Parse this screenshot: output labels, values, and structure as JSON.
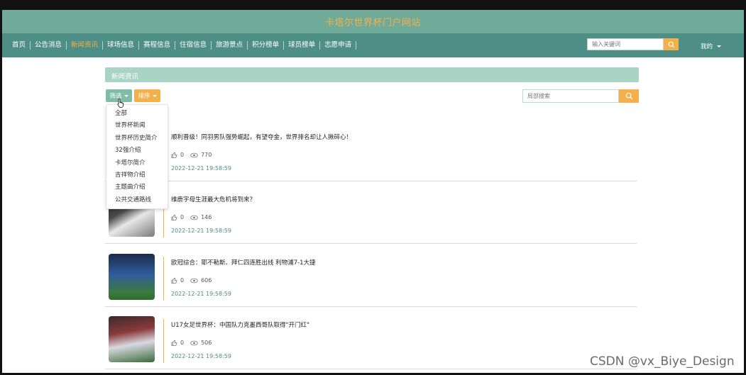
{
  "header": {
    "site_title": "卡塔尔世界杯门户网站"
  },
  "nav": {
    "items": [
      {
        "label": "首页",
        "active": false
      },
      {
        "label": "公告消息",
        "active": false
      },
      {
        "label": "新闻资讯",
        "active": true
      },
      {
        "label": "球场信息",
        "active": false
      },
      {
        "label": "赛程信息",
        "active": false
      },
      {
        "label": "住宿信息",
        "active": false
      },
      {
        "label": "旅游景点",
        "active": false
      },
      {
        "label": "积分榜单",
        "active": false
      },
      {
        "label": "球员榜单",
        "active": false
      },
      {
        "label": "志愿申请",
        "active": false
      }
    ],
    "search_placeholder": "输入关键词",
    "user_menu": "我的"
  },
  "page": {
    "title": "新闻资讯",
    "filter_label": "筛选",
    "sort_label": "排序",
    "local_search_placeholder": "局部搜索"
  },
  "filter_dropdown": [
    "全部",
    "世界杯新闻",
    "世界杯历史简介",
    "32强介绍",
    "卡塔尔简介",
    "吉祥物介绍",
    "主题曲介绍",
    "公共交通路线"
  ],
  "news": [
    {
      "title": "顺利晋级！同羽男队强势崛起，有望夺金，世界排名却让人揪碎心！",
      "likes": "0",
      "views": "770",
      "date": "2022-12-21 19:58:59"
    },
    {
      "title": "维鹿字母生涯最大危机将到来？",
      "likes": "0",
      "views": "146",
      "date": "2022-12-21 19:58:59"
    },
    {
      "title": "欧冠综合：耶不勒斯、拜仁四连胜出线 利物浦7-1大捷",
      "likes": "0",
      "views": "606",
      "date": "2022-12-21 19:58:59"
    },
    {
      "title": "U17女足世界杯：中国队力克墨西哥队取得\"开门红\"",
      "likes": "0",
      "views": "506",
      "date": "2022-12-21 19:58:59"
    }
  ],
  "watermark": "CSDN @vx_Biye_Design",
  "colors": {
    "topbar": "#6fab98",
    "navbar": "#4d8e86",
    "accent": "#f4b04a",
    "header_bar": "#a8d3c5"
  }
}
